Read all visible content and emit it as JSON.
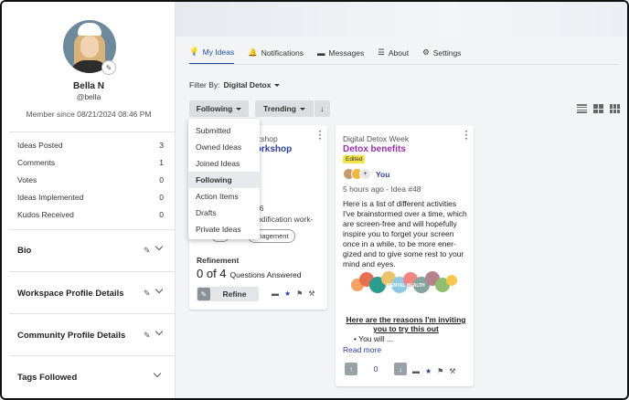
{
  "profile": {
    "name": "Bella N",
    "handle": "@bella",
    "member_since": "Member since 08/21/2024 08:46 PM",
    "stats": [
      {
        "label": "Ideas Posted",
        "value": "3"
      },
      {
        "label": "Comments",
        "value": "1"
      },
      {
        "label": "Votes",
        "value": "0"
      },
      {
        "label": "Ideas Implemented",
        "value": "0"
      },
      {
        "label": "Kudos Received",
        "value": "0"
      }
    ],
    "sections": [
      "Bio",
      "Workspace Profile Details",
      "Community Profile Details",
      "Tags Followed"
    ]
  },
  "tabs": [
    "My Ideas",
    "Notifications",
    "Messages",
    "About",
    "Settings"
  ],
  "filter": {
    "label": "Filter By:",
    "value": "Digital Detox"
  },
  "controls": {
    "following": "Following",
    "trending": "Trending"
  },
  "dropdown": {
    "items": [
      "Submitted",
      "Owned Ideas",
      "Joined Ideas",
      "Following",
      "Action Items",
      "Drafts",
      "Private Ideas"
    ],
    "selected": "Following"
  },
  "card1": {
    "category_partial": "s Workshop",
    "title_partial": "on workshop",
    "meta_partial": "46",
    "line1_partial": "odification work-",
    "chip": "anagement",
    "refinement_label": "Refinement",
    "score": "0 of 4",
    "score_label": "Questions Answered",
    "refine_button": "Refine"
  },
  "card2": {
    "category": "Digital Detox Week",
    "title": "Detox benefits",
    "badge": "Edited",
    "author": "You",
    "meta": "5 hours ago - Idea #48",
    "body": "Here is a list of different activities I've brainstormed over a time, which are screen-free and will hopefully inspire you to forget your screen once in a while, to be more ener-gized and to give some rest to your mind and eyes.",
    "art_caption": "MENTAL HEALTH",
    "bold_text": "Here are the reasons I'm inviting you to try this out",
    "bullet": "• You will ...",
    "read_more": "Read more",
    "vote_count": "0"
  },
  "colors": {
    "accent": "#2d3e9c",
    "title_purple": "#9b2fae",
    "badge": "#f1e44a"
  }
}
